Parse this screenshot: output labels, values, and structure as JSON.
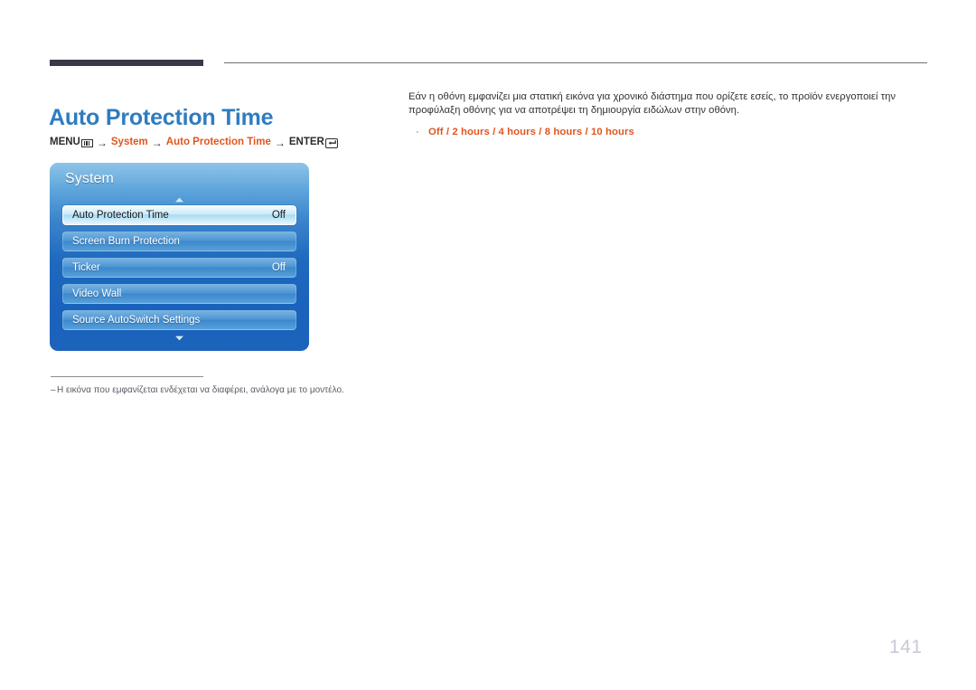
{
  "page": {
    "title": "Auto Protection Time",
    "number": "141",
    "title_color": "#2f7cc0",
    "accent_color": "#e0551f",
    "rule_color": "#3b3847"
  },
  "menu_path": {
    "menu_label": "MENU",
    "menu_icon": "menu-bars-icon",
    "arrow": "→",
    "segments": [
      {
        "text": "System",
        "style": "orange"
      },
      {
        "text": "Auto Protection Time",
        "style": "orange"
      }
    ],
    "enter_label": "ENTER",
    "enter_icon": "enter-return-icon"
  },
  "osd": {
    "title": "System",
    "scroll_up_icon": "chevron-up-icon",
    "scroll_down_icon": "chevron-down-icon",
    "rows": [
      {
        "label": "Auto Protection Time",
        "value": "Off",
        "selected": true
      },
      {
        "label": "Screen Burn Protection",
        "value": "",
        "selected": false
      },
      {
        "label": "Ticker",
        "value": "Off",
        "selected": false
      },
      {
        "label": "Video Wall",
        "value": "",
        "selected": false
      },
      {
        "label": "Source AutoSwitch Settings",
        "value": "",
        "selected": false
      }
    ]
  },
  "description": {
    "paragraph": "Εάν η οθόνη εμφανίζει μια στατική εικόνα για χρονικό διάστημα που ορίζετε εσείς, το προϊόν ενεργοποιεί την προφύλαξη οθόνης για να αποτρέψει τη δημιουργία ειδώλων στην οθόνη.",
    "bullet": "·",
    "options_text": "Off / 2 hours / 4 hours / 8 hours / 10 hours",
    "options": [
      "Off",
      "2 hours",
      "4 hours",
      "8 hours",
      "10 hours"
    ]
  },
  "footnote": {
    "dash": "–",
    "text": "Η εικόνα που εμφανίζεται ενδέχεται να διαφέρει, ανάλογα με το μοντέλο."
  }
}
